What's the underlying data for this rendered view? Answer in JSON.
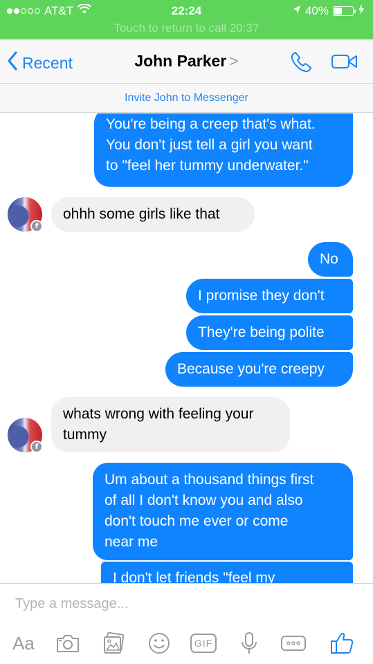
{
  "status_bar": {
    "carrier": "AT&T",
    "time": "22:24",
    "battery": "40%",
    "battery_level": 0.4,
    "call_banner": "Touch to return to call  20:37"
  },
  "nav": {
    "back_label": "Recent",
    "title": "John Parker",
    "title_chevron": ">"
  },
  "invite": {
    "label": "Invite John to Messenger"
  },
  "messages": [
    {
      "from": "me",
      "lines": [
        "You're being a creep that's what.",
        "You don't just tell a girl you want",
        "to \"feel her tummy underwater.\""
      ]
    },
    {
      "from": "them",
      "lines": [
        "ohhh  some girls like that"
      ]
    },
    {
      "from": "me",
      "lines": [
        "No"
      ]
    },
    {
      "from": "me",
      "lines": [
        "I promise they don't"
      ]
    },
    {
      "from": "me",
      "lines": [
        "They're being polite"
      ]
    },
    {
      "from": "me",
      "lines": [
        "Because you're creepy"
      ]
    },
    {
      "from": "them",
      "lines": [
        "whats wrong with feeling your",
        "tummy"
      ]
    },
    {
      "from": "me",
      "lines": [
        "Um about a thousand things first",
        "of all I don't know you and also",
        "don't touch me ever or come",
        "near me"
      ]
    },
    {
      "from": "me",
      "lines": [
        "I don't let friends \"feel my"
      ]
    }
  ],
  "composer": {
    "placeholder": "Type a message...",
    "text_button": "Aa",
    "gif_label": "GIF"
  },
  "colors": {
    "status_green": "#5ed55a",
    "accent_blue": "#1b86f6",
    "outgoing_bubble": "#0f84fe",
    "incoming_bubble": "#f0f0f0"
  },
  "icons": [
    "wifi-icon",
    "location-arrow-icon",
    "battery-icon",
    "charging-icon",
    "back-chevron-icon",
    "phone-icon",
    "video-camera-icon",
    "facebook-badge-icon",
    "camera-icon",
    "photo-icon",
    "emoji-icon",
    "gif-icon",
    "microphone-icon",
    "more-icon",
    "thumbs-up-icon"
  ]
}
